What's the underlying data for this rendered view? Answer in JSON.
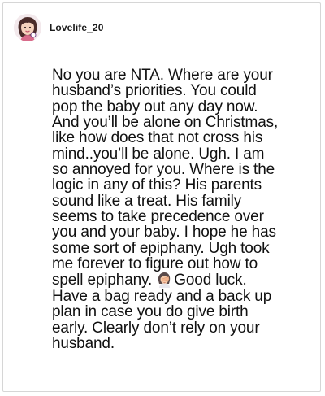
{
  "post": {
    "author": {
      "username": "Lovelife_20",
      "avatar_icon": "cartoon-woman-avatar-icon"
    },
    "comment": {
      "lines": [
        "No you are NTA. Where are your",
        "husband’s priorities. You could",
        "pop the baby out any day now.",
        "And you’ll be alone on Christmas,",
        "like how does that not cross his",
        "mind..you’ll be alone. Ugh. I am",
        "so annoyed for you. Where is the",
        "logic in any of this? His parents",
        "sound like a treat. His family",
        "seems to take precedence over",
        "you and your baby. I hope he has",
        "some sort of epiphany. Ugh took",
        "me forever to figure out how to",
        "Good luck.",
        "Have a bag ready and a back up",
        "plan in case you do give birth",
        "early. Clearly don’t rely on your",
        "husband."
      ],
      "line14_prefix": "spell epiphany.",
      "emoji": "woman-facepalming-emoji-icon"
    }
  },
  "colors": {
    "text": "#111111",
    "border": "#d6d6d6",
    "background": "#ffffff"
  }
}
